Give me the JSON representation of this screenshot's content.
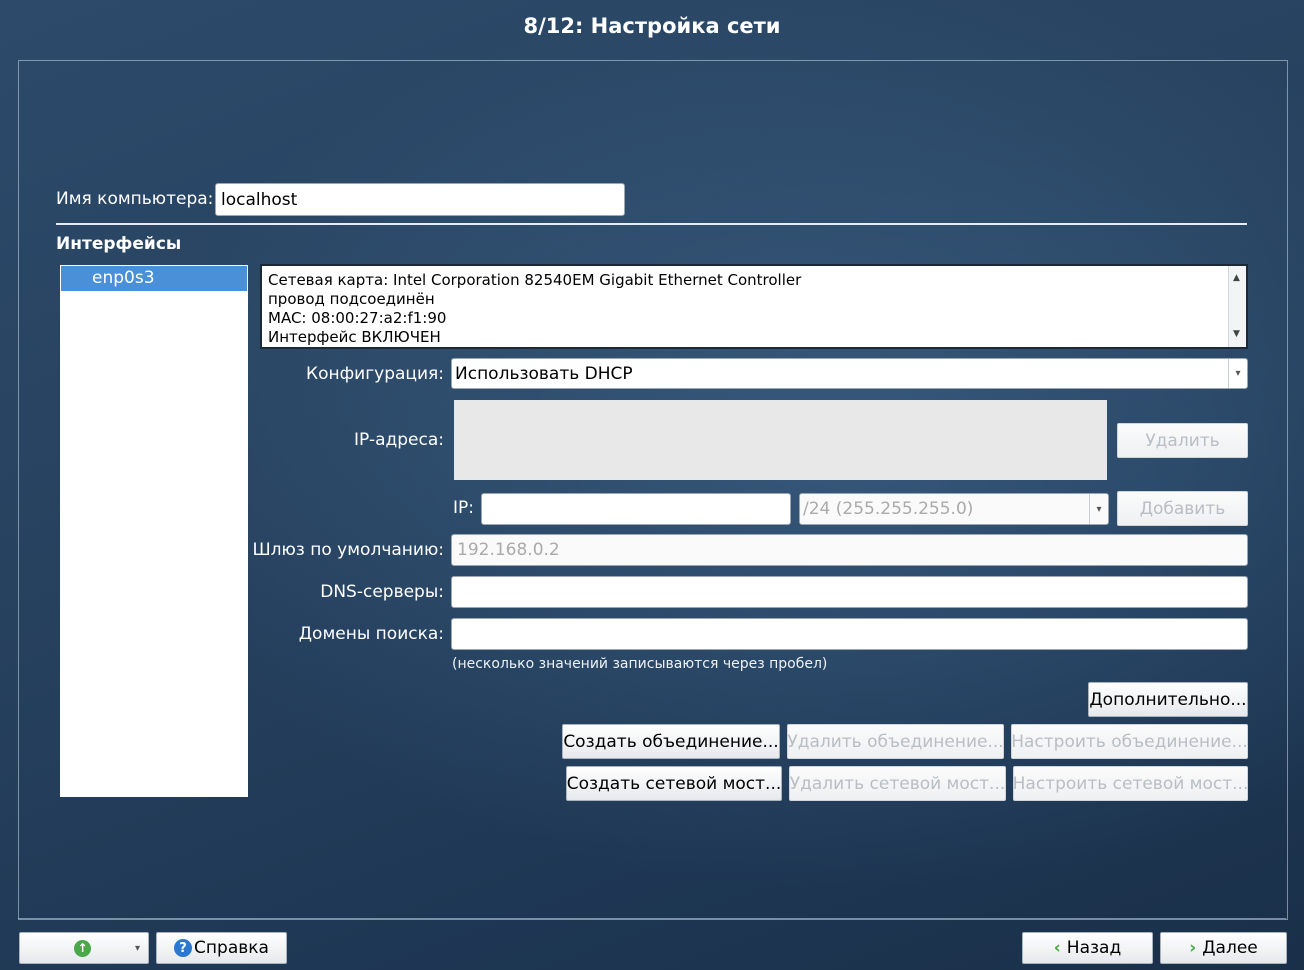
{
  "window": {
    "title": "8/12: Настройка сети"
  },
  "hostname": {
    "label": "Имя компьютера:",
    "value": "localhost"
  },
  "interfaces": {
    "heading": "Интерфейсы",
    "items": [
      {
        "name": "enp0s3",
        "selected": true
      }
    ]
  },
  "info": {
    "lines": [
      "Сетевая карта: Intel Corporation 82540EM Gigabit Ethernet Controller",
      "провод подсоединён",
      "MAC: 08:00:27:a2:f1:90",
      "Интерфейс ВКЛЮЧЕН"
    ]
  },
  "config": {
    "label": "Конфигурация:",
    "value": "Использовать DHCP"
  },
  "ip_addresses": {
    "label": "IP-адреса:",
    "delete_label": "Удалить"
  },
  "ip": {
    "label": "IP:",
    "value": "",
    "mask": "/24 (255.255.255.0)",
    "add_label": "Добавить"
  },
  "gateway": {
    "label": "Шлюз по умолчанию:",
    "placeholder": "192.168.0.2"
  },
  "dns": {
    "label": "DNS-серверы:",
    "value": ""
  },
  "search": {
    "label": "Домены поиска:",
    "value": ""
  },
  "hint": "(несколько значений записываются через пробел)",
  "buttons": {
    "advanced": "Дополнительно...",
    "create_bond": "Создать объединение...",
    "delete_bond": "Удалить объединение...",
    "configure_bond": "Настроить объединение...",
    "create_bridge": "Создать сетевой мост...",
    "delete_bridge": "Удалить сетевой мост...",
    "configure_bridge": "Настроить сетевой мост..."
  },
  "bottom": {
    "help": "Справка",
    "back": "Назад",
    "next": "Далее"
  },
  "colors": {
    "accent": "#4a90d9",
    "help_icon": "#2a78d0",
    "arrow_green": "#4aa84a"
  }
}
